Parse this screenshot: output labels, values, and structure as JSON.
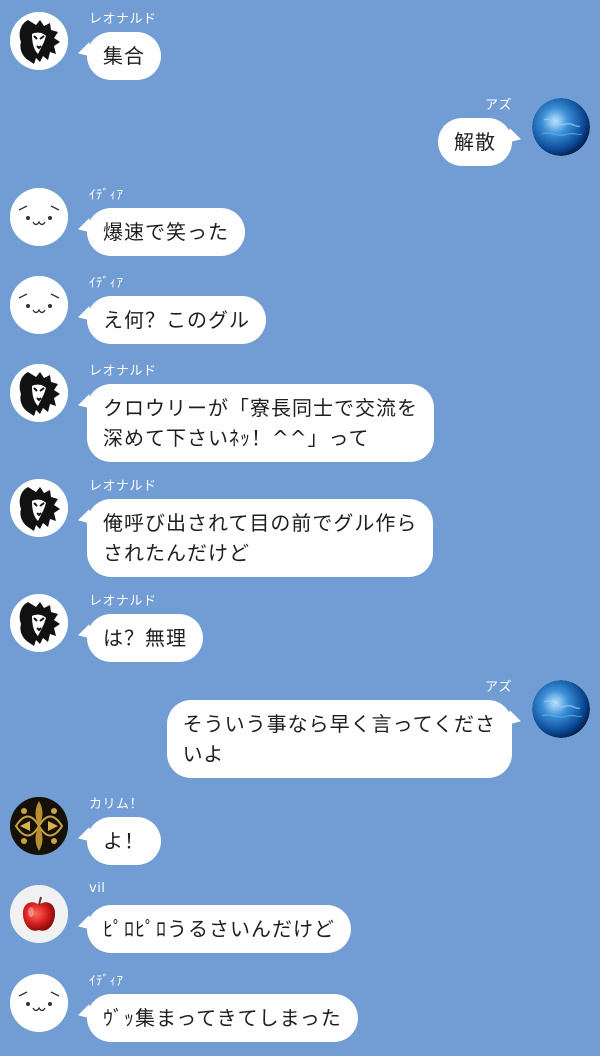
{
  "chat": {
    "background": "#729dd4",
    "messages": [
      {
        "sender": "レオナルド",
        "avatar": "lion-icon",
        "side": "left",
        "text": "集合"
      },
      {
        "sender": "アズ",
        "avatar": "blue-orb-icon",
        "side": "right",
        "text": "解散"
      },
      {
        "sender": "ｲﾃﾞｨｱ",
        "avatar": "face-icon",
        "side": "left",
        "text": "爆速で笑った"
      },
      {
        "sender": "ｲﾃﾞｨｱ",
        "avatar": "face-icon",
        "side": "left",
        "text": "え何？このグル"
      },
      {
        "sender": "レオナルド",
        "avatar": "lion-icon",
        "side": "left",
        "text": "クロウリーが「寮長同士で交流を\n深めて下さいﾈｯ！^^」って"
      },
      {
        "sender": "レオナルド",
        "avatar": "lion-icon",
        "side": "left",
        "text": "俺呼び出されて目の前でグル作ら\nされたんだけど"
      },
      {
        "sender": "レオナルド",
        "avatar": "lion-icon",
        "side": "left",
        "text": "は？無理"
      },
      {
        "sender": "アズ",
        "avatar": "blue-orb-icon",
        "side": "right",
        "text": "そういう事なら早く言ってくださ\nいよ"
      },
      {
        "sender": "カリム！",
        "avatar": "gold-pattern-icon",
        "side": "left",
        "text": "よ！"
      },
      {
        "sender": "vil",
        "avatar": "apple-icon",
        "side": "left",
        "text": "ﾋﾟﾛﾋﾟﾛうるさいんだけど"
      },
      {
        "sender": "ｲﾃﾞｨｱ",
        "avatar": "face-icon",
        "side": "left",
        "text": "ｳﾞｯ集まってきてしまった"
      }
    ]
  }
}
